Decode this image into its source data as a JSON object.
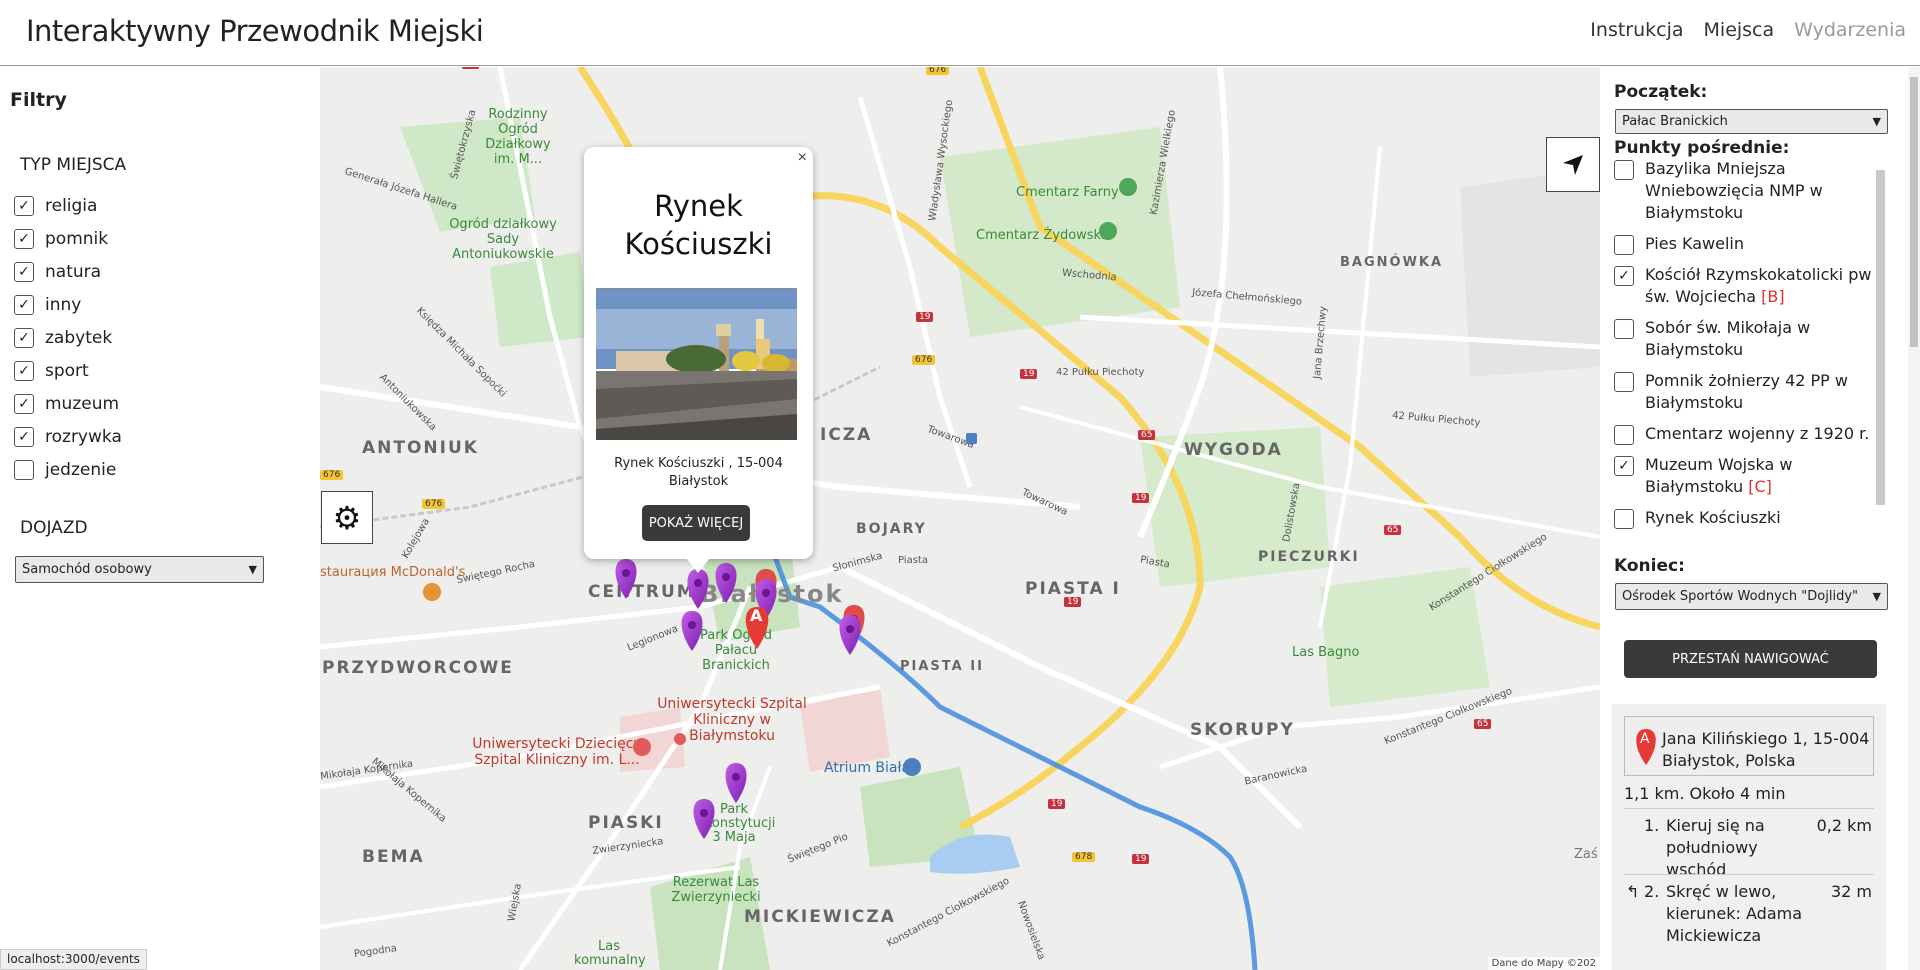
{
  "header": {
    "title": "Interaktywny Przewodnik Miejski",
    "nav": [
      "Instrukcja",
      "Miejsca",
      "Wydarzenia"
    ]
  },
  "filters": {
    "title": "Filtry",
    "type_title": "TYP MIEJSCA",
    "types": [
      {
        "label": "religia",
        "checked": true
      },
      {
        "label": "pomnik",
        "checked": true
      },
      {
        "label": "natura",
        "checked": true
      },
      {
        "label": "inny",
        "checked": true
      },
      {
        "label": "zabytek",
        "checked": true
      },
      {
        "label": "sport",
        "checked": true
      },
      {
        "label": "muzeum",
        "checked": true
      },
      {
        "label": "rozrywka",
        "checked": true
      },
      {
        "label": "jedzenie",
        "checked": false
      }
    ],
    "transport_title": "DOJAZD",
    "transport_value": "Samochód osobowy"
  },
  "map": {
    "popup": {
      "title": "Rynek Kościuszki",
      "address": "Rynek Kościuszki , 15-004 Białystok",
      "button": "POKAŻ WIĘCEJ",
      "close": "×"
    },
    "labels": {
      "rodzinny": "Rodzinny Ogród Działkowy im. M...",
      "ogrod": "Ogród działkowy Sady Antoniukowskie",
      "farny": "Cmentarz Farny",
      "zydowski": "Cmentarz Żydowski",
      "bagnowka": "BAGNÓWKA",
      "antoniuk": "ANTONIUK",
      "wygoda": "WYGODA",
      "bojary": "BOJARY",
      "pieczurki": "PIECZURKI",
      "centrum": "CENTRUM",
      "piasta1": "PIASTA I",
      "piasta2": "PIASTA II",
      "przydworcowe": "PRZYDWORCOWE",
      "skorupy": "SKORUPY",
      "lasbagno": "Las Bagno",
      "parkogrod": "Park Ogród Pałacu Branickich",
      "szpital": "Uniwersytecki Szpital Kliniczny w Białymstoku",
      "dziecie": "Uniwersytecki Dziecięcy Szpital Kliniczny im. L...",
      "atrium": "Atrium Biała",
      "piaski": "PIASKI",
      "parkkonst": "Park Konstytucji 3 Maja",
      "bema": "BEMA",
      "rezerwat": "Rezerwat Las Zwierzyniecki",
      "mickiewicza": "MICKIEWICZA",
      "las": "Las komunalny",
      "mcd": "staurация McDonald's",
      "bialystok": "Białystok",
      "zas": "Zaś",
      "icza": "ICZA"
    },
    "streets": [
      "Generała Józefa Hallera",
      "Świętokrzyska",
      "Władysława Wysockiego",
      "Kazimierza Wielkiego",
      "42 Pułku Piechoty",
      "Wschodnia",
      "Józefa Chełmońskiego",
      "Jana Brzechwy",
      "Towarowa",
      "Słonimska",
      "Piasta",
      "Legionowa",
      "Świętego Rocha",
      "Konstantego Ciołkowskiego",
      "Baranowicka",
      "Zwierzyniecka",
      "Świętego Pio",
      "Mikołaja Kopernika",
      "Pogodna",
      "Wiejska",
      "Kolejowa",
      "Księdza Michała Sopoćki",
      "Antoniukowska",
      "Dolistowska",
      "Nowosielska"
    ],
    "road_numbers": [
      "65",
      "676",
      "19",
      "678"
    ],
    "attribution": "Dane do Mapy ©202"
  },
  "route": {
    "start_label": "Początek:",
    "start_value": "Pałac Branickich",
    "waypoints_label": "Punkty pośrednie:",
    "waypoints": [
      {
        "label": "Bazylika Mniejsza Wniebowzięcia NMP w Białymstoku",
        "checked": false,
        "tag": ""
      },
      {
        "label": "Pies Kawelin",
        "checked": false,
        "tag": ""
      },
      {
        "label": "Kościół Rzymskokatolicki pw św. Wojciecha",
        "checked": true,
        "tag": "[B]"
      },
      {
        "label": "Sobór św. Mikołaja w Białymstoku",
        "checked": false,
        "tag": ""
      },
      {
        "label": "Pomnik żołnierzy 42 PP w Białymstoku",
        "checked": false,
        "tag": ""
      },
      {
        "label": "Cmentarz wojenny z 1920 r.",
        "checked": false,
        "tag": ""
      },
      {
        "label": "Muzeum Wojska w Białymstoku",
        "checked": true,
        "tag": "[C]"
      },
      {
        "label": "Rynek Kościuszki",
        "checked": false,
        "tag": ""
      }
    ],
    "end_label": "Koniec:",
    "end_value": "Ośrodek Sportów Wodnych \"Dojlidy\"",
    "stop_button": "PRZESTAŃ NAWIGOWAĆ"
  },
  "directions": {
    "start_marker": "A",
    "start_address": "Jana Kilińskiego 1, 15-004 Białystok, Polska",
    "summary": "1,1 km. Około 4 min",
    "steps": [
      {
        "num": "1.",
        "text": "Kieruj się na południowy wschód",
        "dist": "0,2 km",
        "icon": ""
      },
      {
        "num": "2.",
        "text": "Skręć w lewo, kierunek: Adama Mickiewicza",
        "dist": "32 m",
        "icon": "↰"
      }
    ]
  },
  "status": {
    "url": "localhost:3000/events"
  },
  "colors": {
    "route": "#4a8fe0",
    "marker_purple": "#9b2fc8",
    "marker_red": "#e53935",
    "button_dark": "#3a3a3a"
  }
}
